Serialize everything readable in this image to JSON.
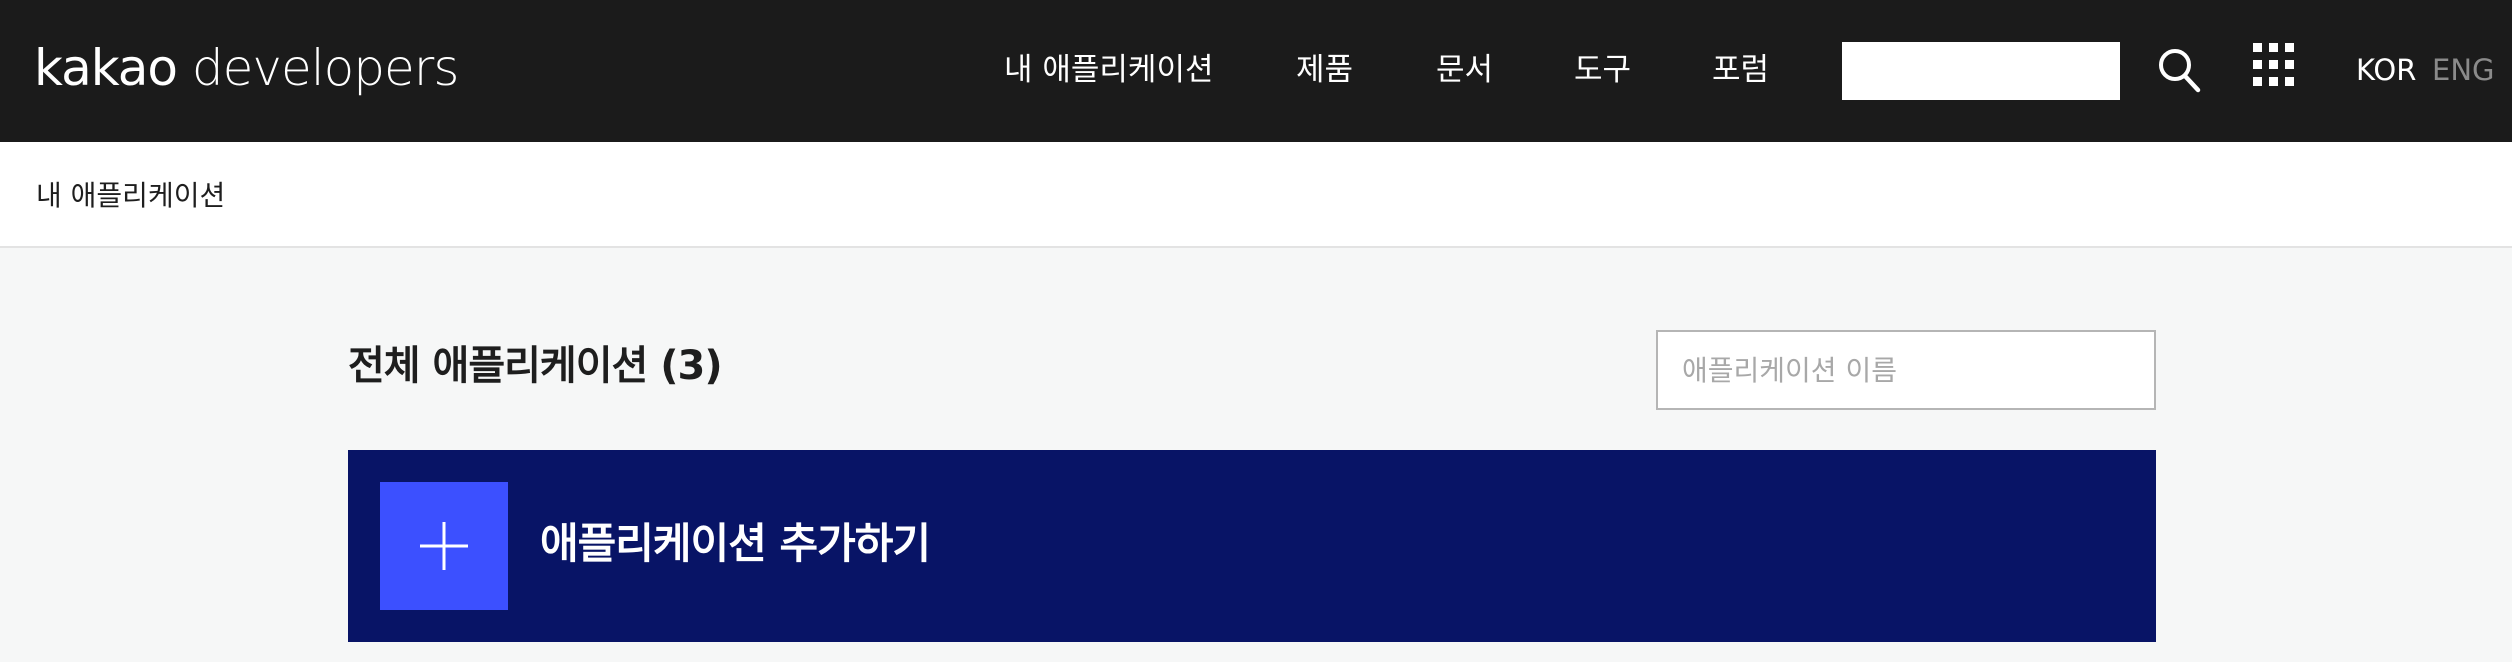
{
  "header": {
    "logo_brand": "kakao",
    "logo_suffix": " developers",
    "menu": [
      {
        "label": "내 애플리케이션"
      },
      {
        "label": "제품"
      },
      {
        "label": "문서"
      },
      {
        "label": "도구"
      },
      {
        "label": "포럼"
      }
    ],
    "search_value": "",
    "search_icon": "search-icon",
    "apps_icon": "grid-icon",
    "lang_kor": "KOR",
    "lang_eng": "ENG"
  },
  "lnb": {
    "title": "내 애플리케이션"
  },
  "main": {
    "heading": "전체 애플리케이션 (3)",
    "search_placeholder": "애플리케이션 이름",
    "add_label": "애플리케이션 추가하기"
  },
  "colors": {
    "header_bg": "#1b1b1b",
    "banner_bg": "#081466",
    "plus_bg": "#3c50ff"
  }
}
